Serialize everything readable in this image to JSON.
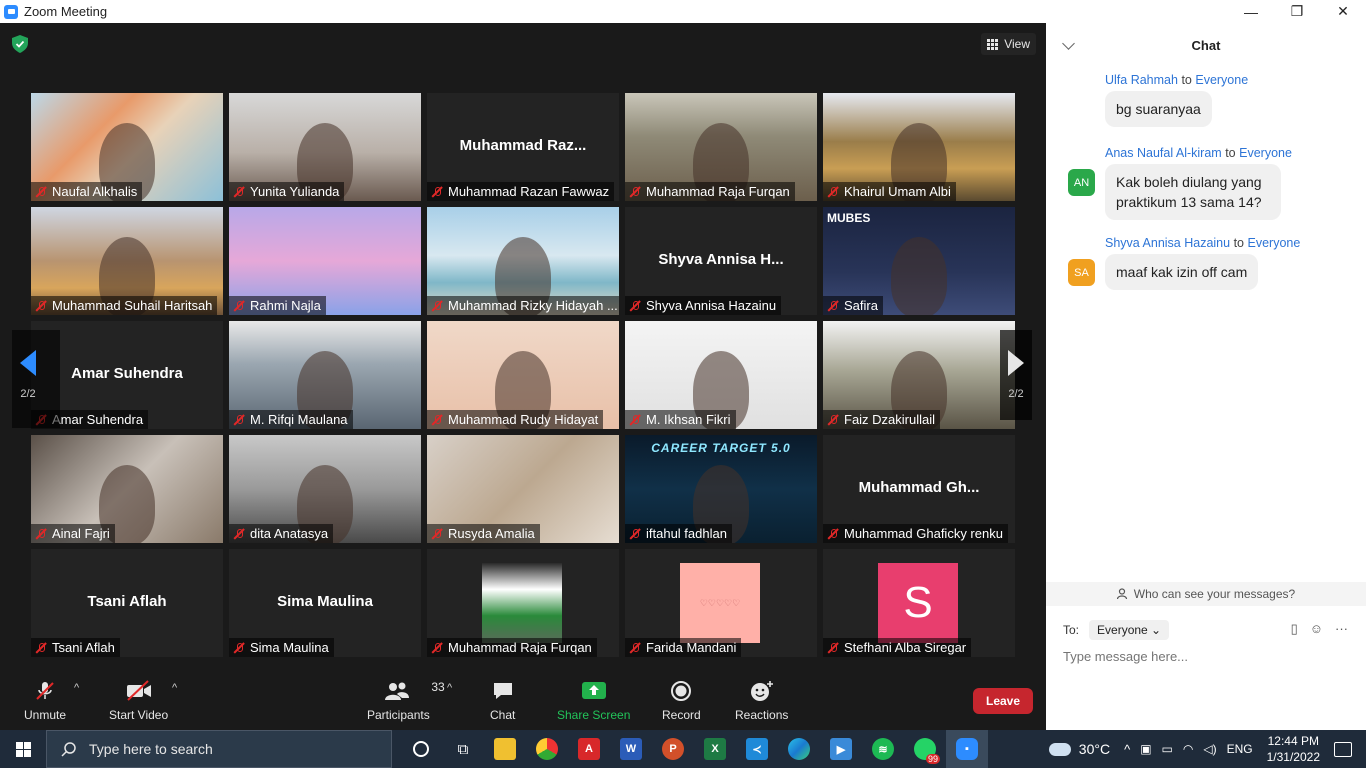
{
  "window": {
    "title": "Zoom Meeting",
    "minimize": "—",
    "maximize": "❐",
    "close": "✕"
  },
  "view_button": {
    "label": "View"
  },
  "tiles": [
    {
      "name": "Naufal Alkhalis",
      "video": "map"
    },
    {
      "name": "Yunita Yulianda",
      "video": "room"
    },
    {
      "name": "Muhammad Razan Fawwaz",
      "video": "none",
      "display": "Muhammad  Raz..."
    },
    {
      "name": "Muhammad Raja Furqan",
      "video": "shed"
    },
    {
      "name": "Khairul Umam Albi",
      "video": "stadium"
    },
    {
      "name": "Muhammad Suhail Haritsah",
      "video": "mountain"
    },
    {
      "name": "Rahmi Najla",
      "video": "city"
    },
    {
      "name": "Muhammad Rizky Hidayah ...",
      "video": "beach"
    },
    {
      "name": "Shyva Annisa Hazainu",
      "video": "none",
      "display": "Shyva  Annisa  H..."
    },
    {
      "name": "Safira",
      "video": "mubes",
      "overlay": "MUBES"
    },
    {
      "name": "Amar Suhendra",
      "video": "none",
      "display": "Amar Suhendra"
    },
    {
      "name": "M. Rifqi Maulana",
      "video": "blur"
    },
    {
      "name": "Muhammad Rudy Hidayat",
      "video": "wall"
    },
    {
      "name": "M. Ikhsan Fikri",
      "video": "white"
    },
    {
      "name": "Faiz Dzakirullail",
      "video": "trees"
    },
    {
      "name": "Ainal Fajri",
      "video": "dark"
    },
    {
      "name": "dita Anatasya",
      "video": "gray"
    },
    {
      "name": "Rusyda Amalia",
      "video": "hand"
    },
    {
      "name": "iftahul fadhlan",
      "video": "career",
      "overlay": "CAREER TARGET 5.0"
    },
    {
      "name": "Muhammad Ghaficky renku",
      "video": "none",
      "display": "Muhammad  Gh..."
    },
    {
      "name": "Tsani Aflah",
      "video": "none",
      "display": "Tsani Aflah"
    },
    {
      "name": "Sima Maulina",
      "video": "none",
      "display": "Sima Maulina"
    },
    {
      "name": "Muhammad Raja Furqan",
      "video": "flag"
    },
    {
      "name": "Farida Mandani",
      "video": "pink",
      "overlay": "♡♡♡♡♡"
    },
    {
      "name": "Stefhani Alba Siregar",
      "video": "avatar",
      "avatar_letter": "S",
      "avatar_color": "#e83e6e"
    }
  ],
  "pagination": {
    "left": "2/2",
    "right": "2/2"
  },
  "toolbar": {
    "unmute": "Unmute",
    "start_video": "Start Video",
    "participants": "Participants",
    "participants_count": "33",
    "chat": "Chat",
    "share_screen": "Share Screen",
    "record": "Record",
    "reactions": "Reactions",
    "leave": "Leave"
  },
  "chat": {
    "title": "Chat",
    "messages": [
      {
        "sender": "Ulfa Rahmah",
        "to_word": "to",
        "recipient": "Everyone",
        "text": "bg suaranyaa",
        "avatar": "",
        "avatar_color": ""
      },
      {
        "sender": "Anas Naufal Al-kiram",
        "to_word": "to",
        "recipient": "Everyone",
        "text": "Kak boleh diulang yang praktikum 13 sama 14?",
        "avatar": "AN",
        "avatar_color": "#2aa84a"
      },
      {
        "sender": "Shyva Annisa Hazainu",
        "to_word": "to",
        "recipient": "Everyone",
        "text": "maaf kak izin off cam",
        "avatar": "SA",
        "avatar_color": "#f0a020"
      }
    ],
    "who_can_see": "Who can see your messages?",
    "to_label": "To:",
    "to_value": "Everyone",
    "placeholder": "Type message here..."
  },
  "taskbar": {
    "search_placeholder": "Type here to search",
    "whatsapp_badge": "99",
    "temperature": "30°C",
    "language": "ENG",
    "time": "12:44 PM",
    "date": "1/31/2022"
  },
  "colors": {
    "accent": "#2d8cff",
    "leave": "#c6262e",
    "share": "#22b14c",
    "muted": "#e02828"
  }
}
